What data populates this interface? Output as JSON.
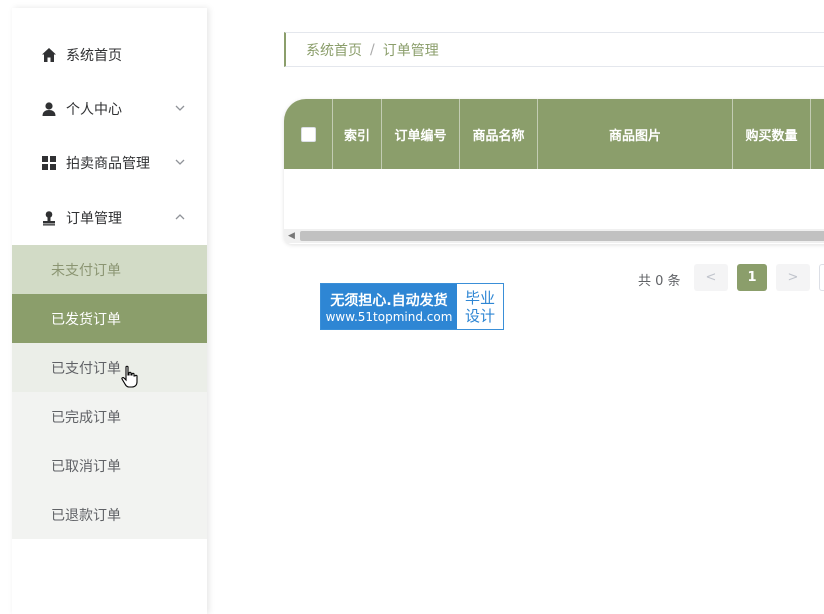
{
  "sidebar": {
    "menu": [
      {
        "label": "系统首页",
        "icon": "home-icon",
        "expandable": false
      },
      {
        "label": "个人中心",
        "icon": "user-icon",
        "expandable": true,
        "expanded": false
      },
      {
        "label": "拍卖商品管理",
        "icon": "grid-icon",
        "expandable": true,
        "expanded": false
      },
      {
        "label": "订单管理",
        "icon": "user-stamp-icon",
        "expandable": true,
        "expanded": true
      }
    ],
    "submenu": [
      {
        "label": "未支付订单",
        "state": "hover"
      },
      {
        "label": "已发货订单",
        "state": "active"
      },
      {
        "label": "已支付订单",
        "state": "pointer"
      },
      {
        "label": "已完成订单",
        "state": "normal"
      },
      {
        "label": "已取消订单",
        "state": "normal"
      },
      {
        "label": "已退款订单",
        "state": "normal"
      }
    ]
  },
  "breadcrumb": {
    "home": "系统首页",
    "separator": "/",
    "current": "订单管理"
  },
  "table": {
    "columns": [
      "索引",
      "订单编号",
      "商品名称",
      "商品图片",
      "购买数量"
    ],
    "rows": []
  },
  "pagination": {
    "total_text": "共 0 条",
    "prev": "<",
    "current_page": "1",
    "next": ">"
  },
  "watermark": {
    "line1": "无须担心.自动发货",
    "line2": "www.51topmind.com",
    "right_top": "毕业",
    "right_bottom": "设计"
  },
  "colors": {
    "accent": "#8b9e6b",
    "accent_light": "#d2dbc6",
    "watermark_blue": "#2e86d4"
  }
}
